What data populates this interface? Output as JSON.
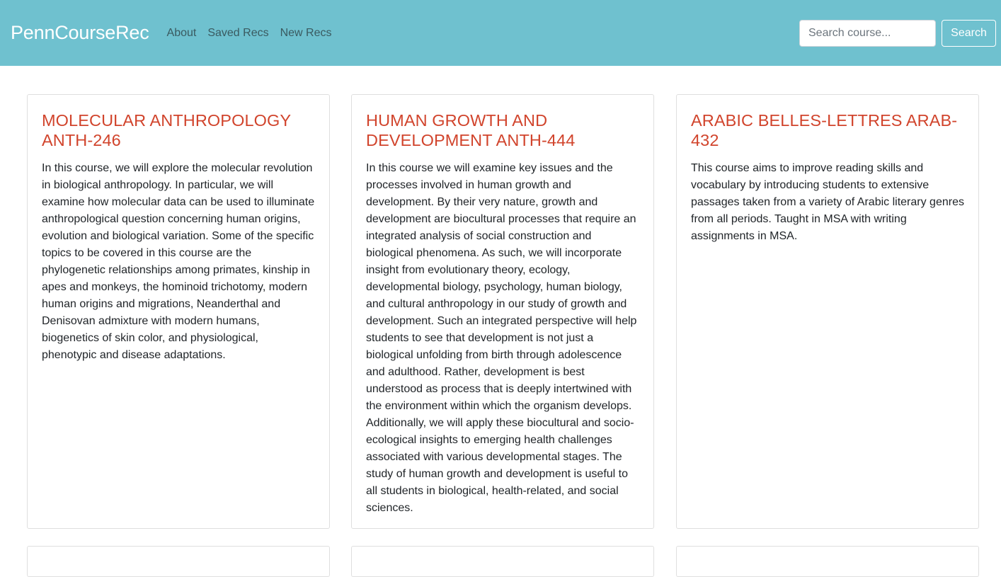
{
  "navbar": {
    "brand": "PennCourseRec",
    "links": [
      "About",
      "Saved Recs",
      "New Recs"
    ],
    "search_placeholder": "Search course...",
    "search_button": "Search",
    "background": "#6fc1cf"
  },
  "courses": [
    {
      "title": "MOLECULAR ANTHROPOLOGY ANTH-246",
      "description": "In this course, we will explore the molecular revolution in biological anthropology. In particular, we will examine how molecular data can be used to illuminate anthropological question concerning human origins, evolution and biological variation. Some of the specific topics to be covered in this course are the phylogenetic relationships among primates, kinship in apes and monkeys, the hominoid trichotomy, modern human origins and migrations, Neanderthal and Denisovan admixture with modern humans, biogenetics of skin color, and physiological, phenotypic and disease adaptations."
    },
    {
      "title": "HUMAN GROWTH AND DEVELOPMENT ANTH-444",
      "description": "In this course we will examine key issues and the processes involved in human growth and development. By their very nature, growth and development are biocultural processes that require an integrated analysis of social construction and biological phenomena. As such, we will incorporate insight from evolutionary theory, ecology, developmental biology, psychology, human biology, and cultural anthropology in our study of growth and development. Such an integrated perspective will help students to see that development is not just a biological unfolding from birth through adolescence and adulthood. Rather, development is best understood as process that is deeply intertwined with the environment within which the organism develops. Additionally, we will apply these biocultural and socio-ecological insights to emerging health challenges associated with various developmental stages. The study of human growth and development is useful to all students in biological, health-related, and social sciences."
    },
    {
      "title": "ARABIC BELLES-LETTRES ARAB-432",
      "description": "This course aims to improve reading skills and vocabulary by introducing students to extensive passages taken from a variety of Arabic literary genres from all periods. Taught in MSA with writing assignments in MSA."
    }
  ],
  "colors": {
    "title": "#d1442c",
    "text": "#212529",
    "card_border": "#dfdfdf"
  }
}
